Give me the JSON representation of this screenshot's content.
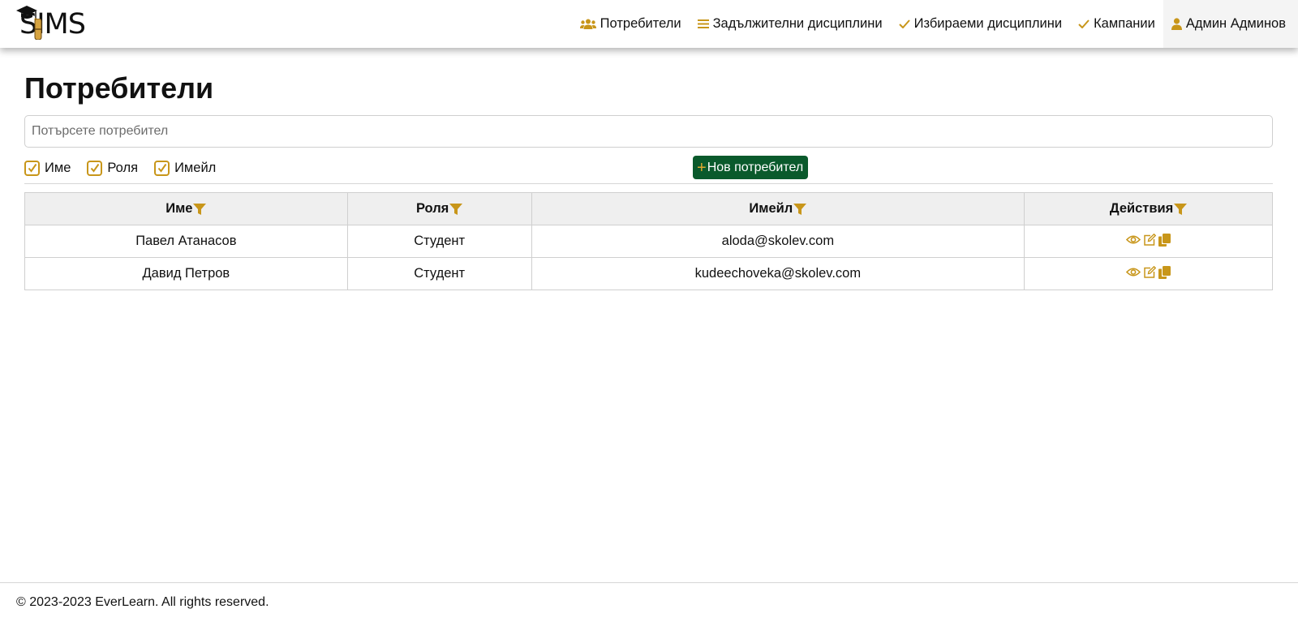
{
  "app": {
    "logo_text": "SIMS"
  },
  "nav": {
    "items": [
      {
        "label": "Потребители",
        "icon": "users-icon"
      },
      {
        "label": "Задължителни дисциплини",
        "icon": "list-icon"
      },
      {
        "label": "Избираеми дисциплини",
        "icon": "check-icon"
      },
      {
        "label": "Кампании",
        "icon": "check-icon"
      },
      {
        "label": "Админ Админов",
        "icon": "user-icon"
      }
    ]
  },
  "page": {
    "title": "Потребители",
    "search_placeholder": "Потърсете потребител",
    "filters": [
      {
        "label": "Име",
        "checked": true
      },
      {
        "label": "Роля",
        "checked": true
      },
      {
        "label": "Имейл",
        "checked": true
      }
    ],
    "new_user_label": "Нов потребител"
  },
  "table": {
    "headers": [
      "Име",
      "Роля",
      "Имейл",
      "Действия"
    ],
    "rows": [
      {
        "name": "Павел Атанасов",
        "role": "Студент",
        "email": "aloda@skolev.com"
      },
      {
        "name": "Давид Петров",
        "role": "Студент",
        "email": "kudeechoveka@skolev.com"
      }
    ],
    "row_actions": [
      "view-icon",
      "edit-icon",
      "copy-icon"
    ]
  },
  "footer": {
    "text": "© 2023-2023 EverLearn. All rights reserved."
  },
  "colors": {
    "accent": "#c8961a",
    "primary_button": "#0a5a2c",
    "header_bg": "#efefef"
  }
}
